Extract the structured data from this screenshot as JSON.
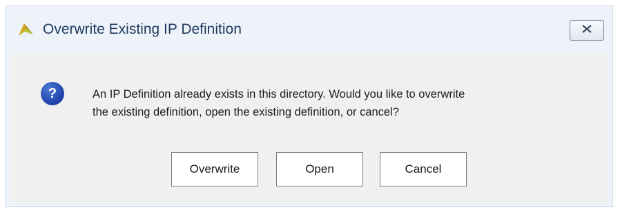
{
  "window": {
    "title": "Overwrite Existing IP Definition",
    "app_icon": "vivado-logo-icon",
    "close_icon": "close-icon"
  },
  "dialog": {
    "icon": "question-icon",
    "icon_glyph": "?",
    "message_line1": "An IP Definition already exists in this directory. Would you like to overwrite",
    "message_line2": "the existing definition, open the existing definition, or cancel?"
  },
  "buttons": {
    "overwrite_label": "Overwrite",
    "open_label": "Open",
    "cancel_label": "Cancel"
  },
  "colors": {
    "title_text": "#1f3a5f",
    "window_frame": "#eef3fa",
    "content_bg": "#f0f0f0",
    "question_icon": "#1e3fa8"
  }
}
